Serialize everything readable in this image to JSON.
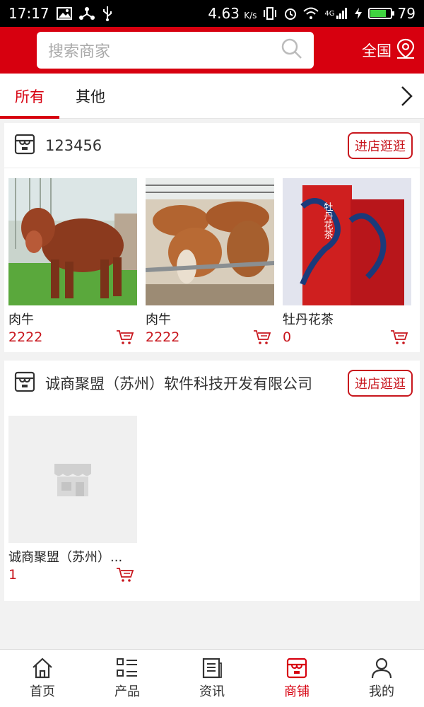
{
  "status_bar": {
    "time": "17:17",
    "speed": "4.63",
    "speed_unit": "K/s",
    "network": "4G",
    "battery": "79"
  },
  "search": {
    "placeholder": "搜索商家"
  },
  "region": {
    "label": "全国"
  },
  "tabs": [
    {
      "label": "所有"
    },
    {
      "label": "其他"
    }
  ],
  "stores": [
    {
      "name": "123456",
      "visit_label": "进店逛逛",
      "products": [
        {
          "name": "肉牛",
          "price": "2222"
        },
        {
          "name": "肉牛",
          "price": "2222"
        },
        {
          "name": "牡丹花茶",
          "price": "0"
        }
      ]
    },
    {
      "name": "诚商聚盟（苏州）软件科技开发有限公司",
      "visit_label": "进店逛逛",
      "products": [
        {
          "name": "诚商聚盟（苏州）...",
          "price": "1"
        }
      ]
    }
  ],
  "tea_box": {
    "title": "牡丹花茶"
  },
  "bottom_nav": [
    {
      "label": "首页"
    },
    {
      "label": "产品"
    },
    {
      "label": "资讯"
    },
    {
      "label": "商铺"
    },
    {
      "label": "我的"
    }
  ],
  "colors": {
    "brand_red": "#d7000f",
    "price_red": "#c8161d",
    "battery_green": "#3fd33f"
  }
}
